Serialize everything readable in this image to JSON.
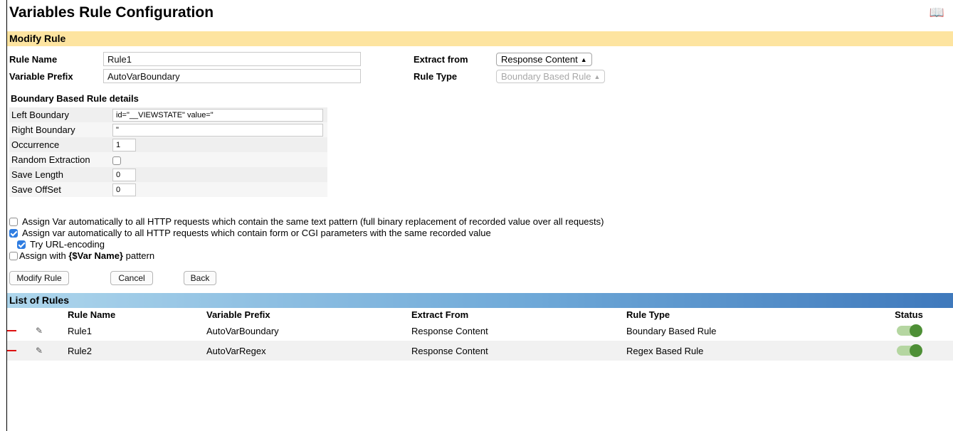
{
  "title": "Variables Rule Configuration",
  "modify_section": {
    "header": "Modify Rule",
    "rule_name_label": "Rule Name",
    "rule_name_value": "Rule1",
    "variable_prefix_label": "Variable Prefix",
    "variable_prefix_value": "AutoVarBoundary",
    "extract_from_label": "Extract from",
    "extract_from_value": "Response Content",
    "rule_type_label": "Rule Type",
    "rule_type_value": "Boundary Based Rule"
  },
  "details": {
    "title": "Boundary Based Rule details",
    "left_boundary_label": "Left Boundary",
    "left_boundary_value": "id=\"__VIEWSTATE\" value=\"",
    "right_boundary_label": "Right Boundary",
    "right_boundary_value": "\"",
    "occurrence_label": "Occurrence",
    "occurrence_value": "1",
    "random_extraction_label": "Random Extraction",
    "random_extraction_checked": false,
    "save_length_label": "Save Length",
    "save_length_value": "0",
    "save_offset_label": "Save OffSet",
    "save_offset_value": "0"
  },
  "options": {
    "assign_text_pattern": "Assign Var automatically to all HTTP requests which contain the same text pattern (full binary replacement of recorded value over all requests)",
    "assign_text_pattern_checked": false,
    "assign_form_params": "Assign var automatically to all HTTP requests which contain form or CGI parameters with the same recorded value",
    "assign_form_params_checked": true,
    "try_url_encoding": "Try URL-encoding",
    "try_url_encoding_checked": true,
    "assign_with_prefix": "Assign with ",
    "assign_with_pattern": "{$Var Name}",
    "assign_with_suffix": " pattern",
    "assign_with_checked": false
  },
  "buttons": {
    "modify": "Modify Rule",
    "cancel": "Cancel",
    "back": "Back"
  },
  "list": {
    "header": "List of Rules",
    "columns": [
      "Rule Name",
      "Variable Prefix",
      "Extract From",
      "Rule Type",
      "Status"
    ],
    "rows": [
      {
        "name": "Rule1",
        "prefix": "AutoVarBoundary",
        "extract": "Response Content",
        "type": "Boundary Based Rule",
        "enabled": true
      },
      {
        "name": "Rule2",
        "prefix": "AutoVarRegex",
        "extract": "Response Content",
        "type": "Regex Based Rule",
        "enabled": true
      }
    ]
  },
  "colors": {
    "modify_header_bg": "#fde4a0",
    "list_header_start": "#aed6ec",
    "list_header_end": "#3f79bc",
    "checkbox_checked": "#2f7de1",
    "toggle_on": "#4e8f36",
    "row_marker": "#dd1111"
  },
  "icons": {
    "help": "book-icon",
    "edit": "edit-icon"
  }
}
